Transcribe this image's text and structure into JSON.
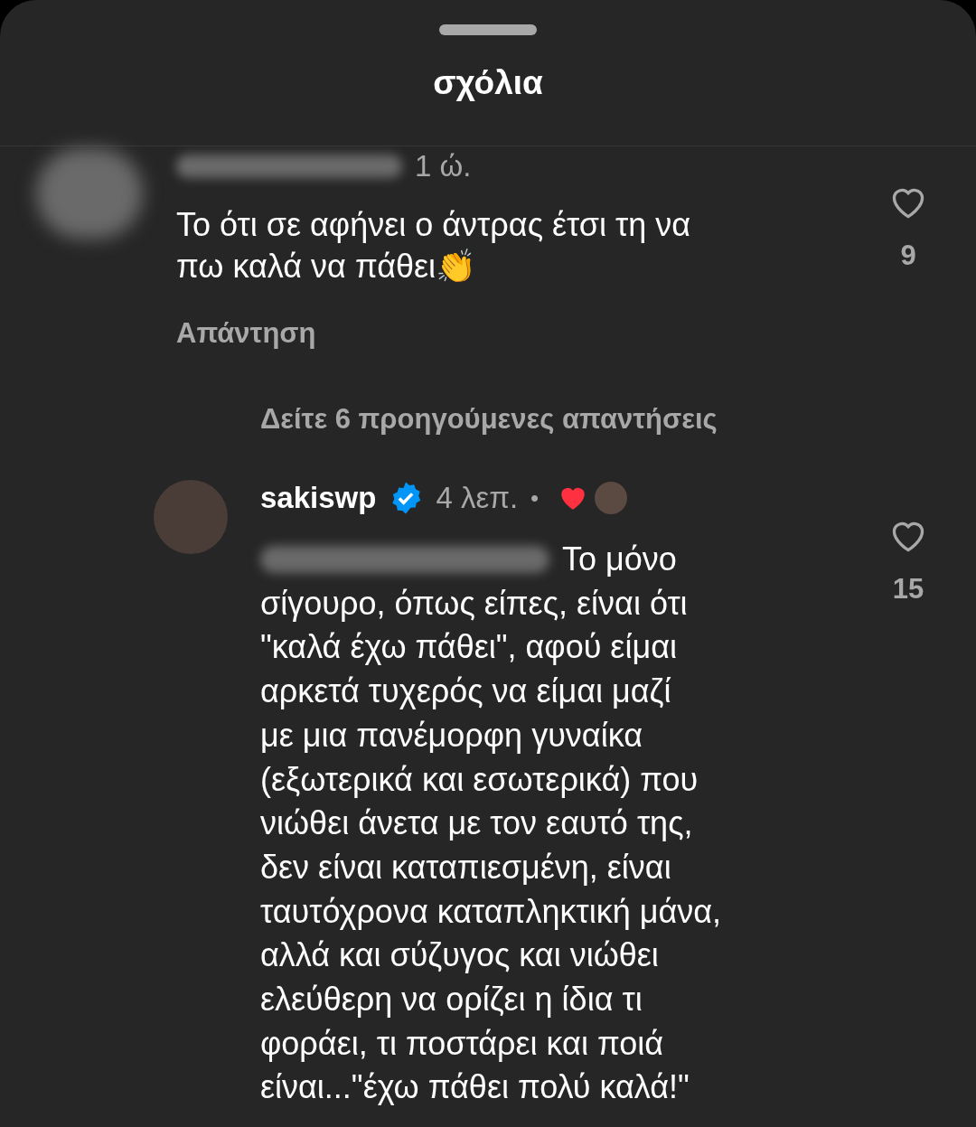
{
  "header": {
    "title": "σχόλια"
  },
  "comments": [
    {
      "username_blurred": true,
      "verified": false,
      "time": "1 ώ.",
      "mention_blurred": false,
      "text": "Το ότι σε αφήνει ο άντρας έτσι τη να\nπω καλά να πάθει👏",
      "liked": false,
      "likes": "9",
      "reply_label": "Απάντηση",
      "reacted_by_author": false
    },
    {
      "username_blurred": false,
      "username": "sakiswp",
      "verified": true,
      "time": "4 λεπ.",
      "separator": "•",
      "mention_blurred": true,
      "text_beside_mention": "Το μόνο",
      "text": "σίγουρο, όπως είπες, είναι ότι\n\"καλά έχω πάθει\", αφού είμαι\nαρκετά τυχερός να είμαι μαζί\nμε μια πανέμορφη γυναίκα\n(εξωτερικά και εσωτερικά) που\nνιώθει άνετα με τον εαυτό της,\nδεν είναι καταπιεσμένη, είναι\nταυτόχρονα καταπληκτική μάνα,\nαλλά και σύζυγος και νιώθει\nελεύθερη να ορίζει η ίδια τι\nφοράει, τι ποστάρει και ποιά\nείναι...\"έχω πάθει πολύ καλά!\"",
      "liked": false,
      "likes": "15",
      "reacted_by_author": true
    }
  ],
  "view_replies": "Δείτε 6 προηγούμενες απαντήσεις"
}
